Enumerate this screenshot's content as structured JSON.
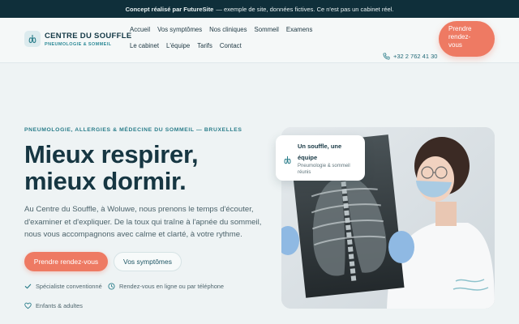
{
  "promo": {
    "strong": "Concept réalisé par FutureSite",
    "rest": "— exemple de site, données fictives. Ce n'est pas un cabinet réel."
  },
  "brand": {
    "title": "CENTRE DU SOUFFLE",
    "subtitle": "PNEUMOLOGIE & SOMMEIL",
    "icon": "lungs-icon"
  },
  "nav": {
    "items": [
      "Accueil",
      "Vos symptômes",
      "Nos cliniques",
      "Sommeil",
      "Examens",
      "Le cabinet",
      "L'équipe",
      "Tarifs",
      "Contact"
    ]
  },
  "header": {
    "phone": "+32 2 762 41 30",
    "cta_line1": "Prendre",
    "cta_line2": "rendez-",
    "cta_line3": "vous"
  },
  "hero": {
    "eyebrow": "PNEUMOLOGIE, ALLERGIES & MÉDECINE DU SOMMEIL — BRUXELLES",
    "headline_line1": "Mieux respirer,",
    "headline_line2": "mieux dormir.",
    "lede": "Au Centre du Souffle, à Woluwe, nous prenons le temps d'écouter, d'examiner et d'expliquer. De la toux qui traîne à l'apnée du sommeil, nous vous accompagnons avec calme et clarté, à votre rythme.",
    "primary_button": "Prendre rendez-vous",
    "secondary_button": "Vos symptômes"
  },
  "perks": [
    {
      "label": "Spécialiste conventionné",
      "icon": "check-icon"
    },
    {
      "label": "Rendez-vous en ligne ou par téléphone",
      "icon": "clock-icon"
    },
    {
      "label": "Enfants & adultes",
      "icon": "heart-icon"
    }
  ],
  "badge": {
    "title": "Un souffle, une équipe",
    "subtitle": "Pneumologie & sommeil réunis"
  },
  "colors": {
    "accent": "#ee7a63",
    "brand_dark": "#163642",
    "teal": "#2a7d8a",
    "promo_bg": "#0f2f3a"
  }
}
